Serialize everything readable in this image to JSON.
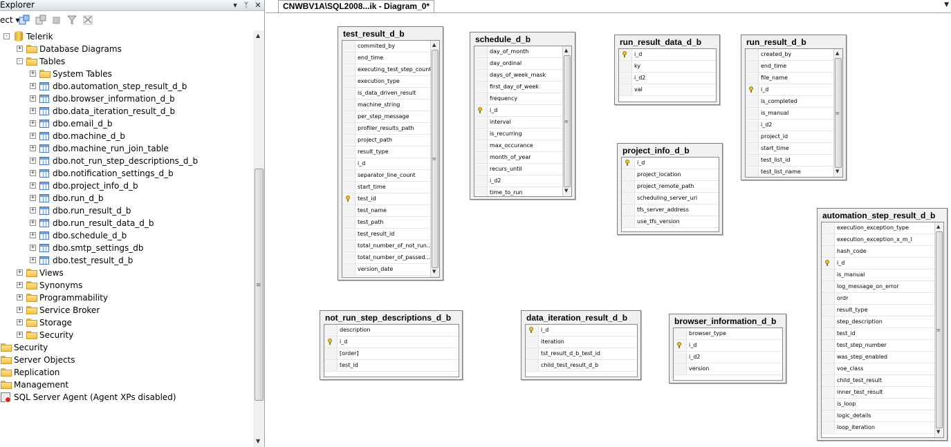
{
  "explorer": {
    "title": "Explorer",
    "connect_label": "ect",
    "tree": [
      {
        "label": "Telerik",
        "icon": "database-icon",
        "indent": 0,
        "expander": "-"
      },
      {
        "label": "Database Diagrams",
        "icon": "folder-icon",
        "indent": 1,
        "expander": "+"
      },
      {
        "label": "Tables",
        "icon": "folder-icon",
        "indent": 1,
        "expander": "-"
      },
      {
        "label": "System Tables",
        "icon": "folder-icon",
        "indent": 2,
        "expander": "+"
      },
      {
        "label": "dbo.automation_step_result_d_b",
        "icon": "table-icon",
        "indent": 2,
        "expander": "+"
      },
      {
        "label": "dbo.browser_information_d_b",
        "icon": "table-icon",
        "indent": 2,
        "expander": "+"
      },
      {
        "label": "dbo.data_iteration_result_d_b",
        "icon": "table-icon",
        "indent": 2,
        "expander": "+"
      },
      {
        "label": "dbo.email_d_b",
        "icon": "table-icon",
        "indent": 2,
        "expander": "+"
      },
      {
        "label": "dbo.machine_d_b",
        "icon": "table-icon",
        "indent": 2,
        "expander": "+"
      },
      {
        "label": "dbo.machine_run_join_table",
        "icon": "table-icon",
        "indent": 2,
        "expander": "+"
      },
      {
        "label": "dbo.not_run_step_descriptions_d_b",
        "icon": "table-icon",
        "indent": 2,
        "expander": "+"
      },
      {
        "label": "dbo.notification_settings_d_b",
        "icon": "table-icon",
        "indent": 2,
        "expander": "+"
      },
      {
        "label": "dbo.project_info_d_b",
        "icon": "table-icon",
        "indent": 2,
        "expander": "+"
      },
      {
        "label": "dbo.run_d_b",
        "icon": "table-icon",
        "indent": 2,
        "expander": "+"
      },
      {
        "label": "dbo.run_result_d_b",
        "icon": "table-icon",
        "indent": 2,
        "expander": "+"
      },
      {
        "label": "dbo.run_result_data_d_b",
        "icon": "table-icon",
        "indent": 2,
        "expander": "+"
      },
      {
        "label": "dbo.schedule_d_b",
        "icon": "table-icon",
        "indent": 2,
        "expander": "+"
      },
      {
        "label": "dbo.smtp_settings_db",
        "icon": "table-icon",
        "indent": 2,
        "expander": "+"
      },
      {
        "label": "dbo.test_result_d_b",
        "icon": "table-icon",
        "indent": 2,
        "expander": "+"
      },
      {
        "label": "Views",
        "icon": "folder-icon",
        "indent": 1,
        "expander": "+"
      },
      {
        "label": "Synonyms",
        "icon": "folder-icon",
        "indent": 1,
        "expander": "+"
      },
      {
        "label": "Programmability",
        "icon": "folder-icon",
        "indent": 1,
        "expander": "+"
      },
      {
        "label": "Service Broker",
        "icon": "folder-icon",
        "indent": 1,
        "expander": "+"
      },
      {
        "label": "Storage",
        "icon": "folder-icon",
        "indent": 1,
        "expander": "+"
      },
      {
        "label": "Security",
        "icon": "folder-icon",
        "indent": 1,
        "expander": "+"
      },
      {
        "label": "Security",
        "icon": "folder-icon",
        "indent": -1,
        "expander": ""
      },
      {
        "label": "Server Objects",
        "icon": "folder-icon",
        "indent": -1,
        "expander": ""
      },
      {
        "label": "Replication",
        "icon": "folder-icon",
        "indent": -1,
        "expander": ""
      },
      {
        "label": "Management",
        "icon": "folder-icon",
        "indent": -1,
        "expander": ""
      },
      {
        "label": "SQL Server Agent (Agent XPs disabled)",
        "icon": "agent-icon",
        "indent": -1,
        "expander": ""
      }
    ]
  },
  "document": {
    "tab_title": "CNWBV1A\\SQL2008...ik - Diagram_0*"
  },
  "diagram": {
    "tables": [
      {
        "name": "test_result_d_b",
        "key_rows": [
          13
        ],
        "scroll": true,
        "columns": [
          "commited_by",
          "end_time",
          "executing_test_step_count",
          "execution_type",
          "is_data_driven_result",
          "machine_string",
          "per_step_message",
          "profiler_results_path",
          "project_path",
          "result_type",
          "i_d",
          "separator_line_count",
          "start_time",
          "test_id",
          "test_name",
          "test_path",
          "test_result_id",
          "total_number_of_not_run...",
          "total_number_of_passed...",
          "version_date"
        ]
      },
      {
        "name": "schedule_d_b",
        "key_rows": [
          5
        ],
        "scroll": true,
        "columns": [
          "day_of_month",
          "day_ordinal",
          "days_of_week_mask",
          "first_day_of_week",
          "frequency",
          "i_d",
          "interval",
          "is_recurring",
          "max_occurance",
          "month_of_year",
          "recurs_until",
          "i_d2",
          "time_to_run"
        ]
      },
      {
        "name": "run_result_data_d_b",
        "key_rows": [
          0
        ],
        "scroll": false,
        "columns": [
          "i_d",
          "ky",
          "i_d2",
          "val"
        ]
      },
      {
        "name": "run_result_d_b",
        "key_rows": [
          3
        ],
        "scroll": true,
        "columns": [
          "created_by",
          "end_time",
          "file_name",
          "i_d",
          "is_completed",
          "is_manual",
          "i_d2",
          "project_id",
          "start_time",
          "test_list_id",
          "test_list_name"
        ]
      },
      {
        "name": "project_info_d_b",
        "key_rows": [
          0
        ],
        "scroll": false,
        "columns": [
          "i_d",
          "project_location",
          "project_remote_path",
          "scheduling_server_uri",
          "tfs_server_address",
          "use_tfs_version"
        ]
      },
      {
        "name": "automation_step_result_d_b",
        "key_rows": [
          3
        ],
        "scroll": true,
        "columns": [
          "execution_exception_type",
          "execution_exception_x_m_l",
          "hash_code",
          "i_d",
          "is_manual",
          "log_message_on_error",
          "ordr",
          "result_type",
          "step_description",
          "test_id",
          "test_step_number",
          "was_step_enabled",
          "voe_class",
          "child_test_result",
          "inner_test_result",
          "is_loop",
          "logic_details",
          "loop_iteration"
        ]
      },
      {
        "name": "not_run_step_descriptions_d_b",
        "key_rows": [
          1
        ],
        "scroll": false,
        "columns": [
          "description",
          "i_d",
          "[order]",
          "test_id"
        ]
      },
      {
        "name": "data_iteration_result_d_b",
        "key_rows": [
          0
        ],
        "scroll": false,
        "columns": [
          "i_d",
          "iteration",
          "tst_result_d_b_test_id",
          "child_test_result_d_b"
        ]
      },
      {
        "name": "browser_information_d_b",
        "key_rows": [
          1
        ],
        "scroll": false,
        "columns": [
          "browser_type",
          "i_d",
          "i_d2",
          "version"
        ]
      }
    ]
  }
}
